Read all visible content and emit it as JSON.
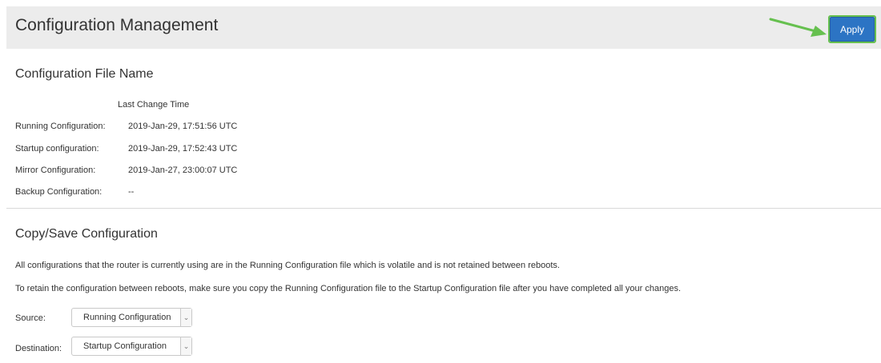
{
  "header": {
    "title": "Configuration Management",
    "apply_label": "Apply"
  },
  "file_name_section": {
    "title": "Configuration File Name",
    "column_header": "Last Change Time",
    "rows": [
      {
        "label": "Running Configuration:",
        "value": "2019-Jan-29, 17:51:56 UTC"
      },
      {
        "label": "Startup configuration:",
        "value": "2019-Jan-29, 17:52:43 UTC"
      },
      {
        "label": "Mirror Configuration:",
        "value": "2019-Jan-27, 23:00:07 UTC"
      },
      {
        "label": "Backup Configuration:",
        "value": "--"
      }
    ]
  },
  "copy_section": {
    "title": "Copy/Save Configuration",
    "info_1": "All configurations that the router is currently using are in the Running Configuration file which is volatile and is not retained between reboots.",
    "info_2": "To retain the configuration between reboots, make sure you copy the Running Configuration file to the Startup Configuration file after you have completed all your changes.",
    "source_label": "Source:",
    "source_value": "Running Configuration",
    "destination_label": "Destination:",
    "destination_value": "Startup Configuration"
  },
  "icons": {
    "annotation_arrow": "arrow-right-icon",
    "dropdown_caret": "chevron-down-icon"
  },
  "colors": {
    "header_bg": "#ececec",
    "apply_bg": "#2c74c4",
    "highlight": "#66c04f"
  }
}
